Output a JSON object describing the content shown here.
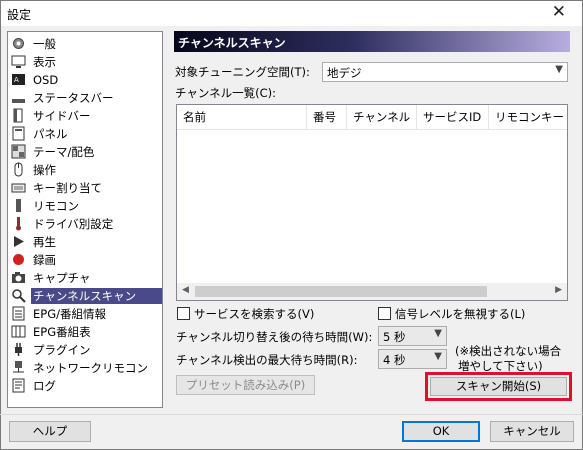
{
  "window": {
    "title": "設定",
    "close_glyph": "✕"
  },
  "sidebar": {
    "items": [
      {
        "label": "一般",
        "icon": "gear-icon",
        "selected": false
      },
      {
        "label": "表示",
        "icon": "display-icon",
        "selected": false
      },
      {
        "label": "OSD",
        "icon": "osd-icon",
        "selected": false
      },
      {
        "label": "ステータスバー",
        "icon": "statusbar-icon",
        "selected": false
      },
      {
        "label": "サイドバー",
        "icon": "sidebar-icon",
        "selected": false
      },
      {
        "label": "パネル",
        "icon": "panel-icon",
        "selected": false
      },
      {
        "label": "テーマ/配色",
        "icon": "theme-icon",
        "selected": false
      },
      {
        "label": "操作",
        "icon": "mouse-icon",
        "selected": false
      },
      {
        "label": "キー割り当て",
        "icon": "keyboard-icon",
        "selected": false
      },
      {
        "label": "リモコン",
        "icon": "remote-icon",
        "selected": false
      },
      {
        "label": "ドライバ別設定",
        "icon": "driver-icon",
        "selected": false
      },
      {
        "label": "再生",
        "icon": "play-icon",
        "selected": false
      },
      {
        "label": "録画",
        "icon": "record-icon",
        "selected": false
      },
      {
        "label": "キャプチャ",
        "icon": "camera-icon",
        "selected": false
      },
      {
        "label": "チャンネルスキャン",
        "icon": "scan-icon",
        "selected": true
      },
      {
        "label": "EPG/番組情報",
        "icon": "epg-icon",
        "selected": false
      },
      {
        "label": "EPG番組表",
        "icon": "epg-table-icon",
        "selected": false
      },
      {
        "label": "プラグイン",
        "icon": "plugin-icon",
        "selected": false
      },
      {
        "label": "ネットワークリモコン",
        "icon": "network-icon",
        "selected": false
      },
      {
        "label": "ログ",
        "icon": "log-icon",
        "selected": false
      }
    ]
  },
  "panel": {
    "header": "チャンネルスキャン",
    "tuning_space_label": "対象チューニング空間(T):",
    "tuning_space_value": "地デジ",
    "channel_list_label": "チャンネル一覧(C):",
    "columns": [
      "名前",
      "番号",
      "チャンネル",
      "サービスID",
      "リモコンキー"
    ],
    "search_services_label": "サービスを検索する(V)",
    "ignore_signal_label": "信号レベルを無視する(L)",
    "switch_wait_label": "チャンネル切り替え後の待ち時間(W):",
    "switch_wait_value": "5 秒",
    "detect_wait_label": "チャンネル検出の最大待ち時間(R):",
    "detect_wait_value": "4 秒",
    "detect_note_line1": "(※検出されない場合",
    "detect_note_line2": "増やして下さい)",
    "preset_button": "プリセット読み込み(P)",
    "scan_button": "スキャン開始(S)"
  },
  "footer": {
    "help": "ヘルプ",
    "ok": "OK",
    "cancel": "キャンセル"
  }
}
